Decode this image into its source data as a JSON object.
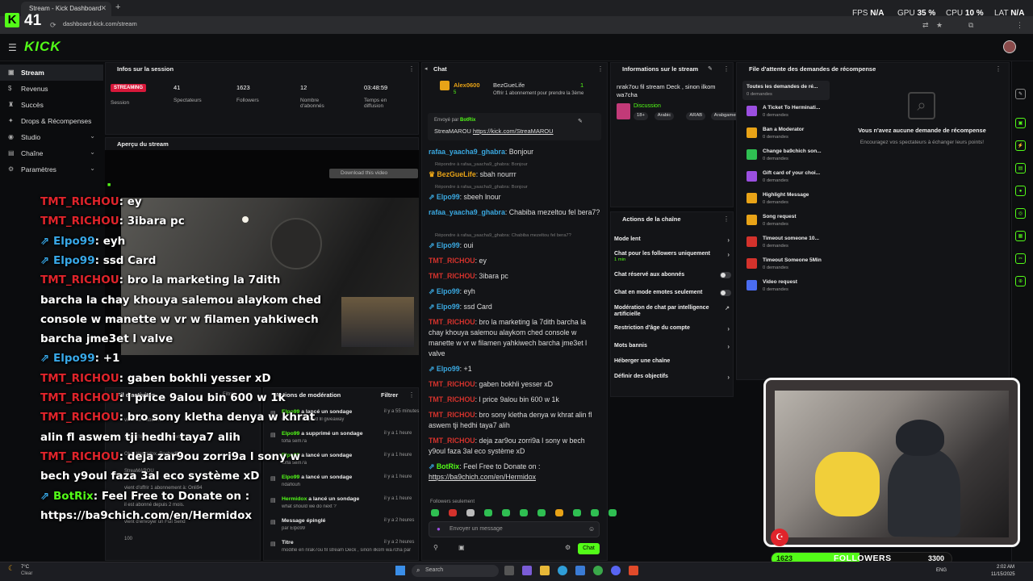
{
  "browser": {
    "tab_title": "Stream - Kick Dashboard",
    "url": "dashboard.kick.com/stream"
  },
  "hud": {
    "fps_label": "FPS",
    "fps_val": "N/A",
    "gpu_label": "GPU",
    "gpu_val": "35 %",
    "cpu_label": "CPU",
    "cpu_val": "10 %",
    "lat_label": "LAT",
    "lat_val": "N/A",
    "counter": "41"
  },
  "nav": {
    "logo": "KICK"
  },
  "sidebar": {
    "items": [
      {
        "label": "Stream"
      },
      {
        "label": "Revenus"
      },
      {
        "label": "Succès"
      },
      {
        "label": "Drops & Récompenses"
      },
      {
        "label": "Studio"
      },
      {
        "label": "Chaîne"
      },
      {
        "label": "Paramètres"
      }
    ]
  },
  "session": {
    "title": "Infos sur la session",
    "status": "STREAMING",
    "session_label": "Session",
    "viewers_val": "41",
    "viewers_label": "Spectateurs",
    "followers_val": "1623",
    "followers_label": "Followers",
    "subs_val": "12",
    "subs_label": "Nombre d'abonnés",
    "time_val": "03:48:59",
    "time_label": "Temps en diffusion"
  },
  "preview": {
    "title": "Aperçu du stream",
    "download": "Download this video"
  },
  "overlay": [
    {
      "user": "TMT_RICHOU",
      "msg": ": ey"
    },
    {
      "user": "TMT_RICHOU",
      "msg": ": 3ibara pc"
    },
    {
      "user": "Elpo99",
      "msg": ": eyh"
    },
    {
      "user": "Elpo99",
      "msg": ": ssd Card"
    },
    {
      "user": "TMT_RICHOU",
      "msg": ": bro la marketing la 7dith"
    },
    {
      "msg": "barcha la chay khouya salemou alaykom ched"
    },
    {
      "msg": "console w manette w vr w filamen yahkiwech"
    },
    {
      "msg": "barcha jme3et l valve"
    },
    {
      "user": "Elpo99",
      "msg": ": +1"
    },
    {
      "user": "TMT_RICHOU",
      "msg": ": gaben bokhli yesser xD"
    },
    {
      "user": "TMT_RICHOU",
      "msg": ": l price 9alou bin 600 w 1k"
    },
    {
      "user": "TMT_RICHOU",
      "msg": ": bro sony kletha denya w khrat"
    },
    {
      "msg": "alin fl aswem tji hedhi taya7 alih"
    },
    {
      "user": "TMT_RICHOU",
      "msg": ": deja zar9ou zorri9a l sony w"
    },
    {
      "msg": "bech y9oul faza 3al eco système xD"
    },
    {
      "user": "BotRix",
      "msg": ": Feel Free to Donate on :"
    },
    {
      "msg": "https://ba9chich.com/en/Hermidox"
    }
  ],
  "activity": {
    "title": "Fil d'activités",
    "filter": "Filtrer",
    "items": [
      {
        "t": "vient de s'abonner"
      },
      {
        "t": "vient d'offrir 5 abonnements à"
      },
      {
        "t": "Oka_Hermidox, Rached95,"
      },
      {
        "t": "StreaMAROU"
      },
      {
        "t": "vient d'offrir 1 abonnement à: Onli94"
      },
      {
        "t": "il est abonné depuis 2 mois."
      },
      {
        "t": "vient d'envoyer un Full Send"
      },
      {
        "t": "100"
      }
    ]
  },
  "moderation": {
    "title": "Actions de modération",
    "filter": "Filtrer",
    "items": [
      {
        "user": "Elpo99",
        "action": "a lancé un sondage",
        "time": "il y a 55 minutes",
        "sub": "chkoun mawjoud lil giveaway"
      },
      {
        "user": "Elpo99",
        "action": "a supprimé un sondage",
        "time": "il y a 1 heure",
        "sub": "tofla sem7a"
      },
      {
        "user": "Elpo99",
        "action": "a lancé un sondage",
        "time": "il y a 1 heure",
        "sub": "tofla sem7a"
      },
      {
        "user": "Elpo99",
        "action": "a lancé un sondage",
        "time": "il y a 1 heure",
        "sub": "ndaflouh"
      },
      {
        "user": "Hermidox",
        "action": "a lancé un sondage",
        "time": "il y a 1 heure",
        "sub": "what should we do next ?"
      },
      {
        "user": "",
        "action": "Message épinglé",
        "time": "il y a 2 heures",
        "sub": "par Elpo99"
      },
      {
        "user": "",
        "action": "Titre",
        "time": "il y a 2 heures",
        "sub": "modifié en nrak7ou fil stream Deck , sinon ilkom wa7cha par Elpo99"
      }
    ]
  },
  "chat": {
    "title": "Chat",
    "top_user": "Alex0600",
    "top_user2": "BezGueLife",
    "top_offer": "Offrir 1 abonnement pour prendre la 3ème",
    "top_count": "1",
    "top_sub": "5",
    "pinned_by": "Envoyé par",
    "pinned_bot": "BotRix",
    "pinned_user": "StreaMAROU",
    "pinned_link": "https://kick.com/StreaMAROU",
    "lines": [
      {
        "u": "rafaa_yaacha9_ghabra",
        "c": "b",
        "m": ": Bonjour"
      },
      {
        "reply": "Répondre à rafaa_yaacha9_ghabra: Bonjour"
      },
      {
        "u": "BezGueLife",
        "c": "y",
        "m": ": sbah nourrr"
      },
      {
        "reply": "Répondre à rafaa_yaacha9_ghabra: Bonjour"
      },
      {
        "u": "Elpo99",
        "c": "b",
        "m": ": sbeeh lnour"
      },
      {
        "u": "rafaa_yaacha9_ghabra",
        "c": "b",
        "m": ": Chabiba mezeltou fel bera7?"
      },
      {
        "reply": "Répondre à rafaa_yaacha9_ghabra: Chabiba mezeltou fel bera7?"
      },
      {
        "u": "Elpo99",
        "c": "b",
        "m": ": oui"
      },
      {
        "u": "TMT_RICHOU",
        "c": "r",
        "m": ": ey"
      },
      {
        "u": "TMT_RICHOU",
        "c": "r",
        "m": ": 3ibara pc"
      },
      {
        "u": "Elpo99",
        "c": "b",
        "m": ": eyh"
      },
      {
        "u": "Elpo99",
        "c": "b",
        "m": ": ssd Card"
      },
      {
        "u": "TMT_RICHOU",
        "c": "r",
        "m": ": bro la marketing la 7dith barcha la chay khouya salemou alaykom ched console w manette w vr w filamen yahkiwech barcha jme3et l valve"
      },
      {
        "u": "Elpo99",
        "c": "b",
        "m": ": +1"
      },
      {
        "u": "TMT_RICHOU",
        "c": "r",
        "m": ": gaben bokhli yesser xD"
      },
      {
        "u": "TMT_RICHOU",
        "c": "r",
        "m": ": l price 9alou bin 600 w 1k"
      },
      {
        "u": "TMT_RICHOU",
        "c": "r",
        "m": ": bro sony kletha denya w khrat alin fl aswem tji hedhi taya7 alih"
      },
      {
        "u": "TMT_RICHOU",
        "c": "r",
        "m": ": deja zar9ou zorri9a l sony w bech y9oul faza 3al eco système xD"
      },
      {
        "u": "BotRix",
        "c": "g",
        "m": ": Feel Free to Donate on :",
        "link": "https://ba9chich.com/en/Hermidox"
      }
    ],
    "followers_only": "Followers seulement",
    "placeholder": "Envoyer un message",
    "send": "Chat"
  },
  "streaminfo": {
    "title": "Informations sur le stream",
    "stream_title": "nrak7ou fil stream Deck , sinon ilkom wa7cha",
    "category": "Discussion",
    "tags": [
      "18+",
      "Arabic",
      "ARAB",
      "Arabgamer"
    ]
  },
  "channel_actions": {
    "title": "Actions de la chaîne",
    "items": [
      {
        "label": "Mode lent",
        "type": "chev"
      },
      {
        "label": "Chat pour les followers uniquement",
        "sub": "1 min",
        "type": "chev"
      },
      {
        "label": "Chat réservé aux abonnés",
        "type": "toggle"
      },
      {
        "label": "Chat en mode emotes seulement",
        "type": "toggle"
      },
      {
        "label": "Modération de chat par intelligence artificielle",
        "type": "ext"
      },
      {
        "label": "Restriction d'âge du compte",
        "type": "chev"
      },
      {
        "label": "Mots bannis",
        "type": "chev"
      },
      {
        "label": "Héberger une chaîne",
        "type": "none"
      },
      {
        "label": "Définir des objectifs",
        "type": "chev"
      }
    ]
  },
  "rewards": {
    "title": "File d'attente des demandes de récompense",
    "all": "Toutes les demandes de ré...",
    "all_sub": "0 demandes",
    "empty_title": "Vous n'avez aucune demande de récompense",
    "empty_sub": "Encouragez vos spectateurs à échanger leurs points!",
    "items": [
      {
        "label": "A Ticket To Herminati...",
        "sub": "0 demandes",
        "color": "#9b4fe0"
      },
      {
        "label": "Ban a Moderator",
        "sub": "0 demandes",
        "color": "#e8a317"
      },
      {
        "label": "Change ba9chich son...",
        "sub": "0 demandes",
        "color": "#2fbf52"
      },
      {
        "label": "Gift card of your choi...",
        "sub": "0 demandes",
        "color": "#9b4fe0"
      },
      {
        "label": "Highlight Message",
        "sub": "0 demandes",
        "color": "#e8a317"
      },
      {
        "label": "Song request",
        "sub": "0 demandes",
        "color": "#e8a317"
      },
      {
        "label": "Timeout someone 10...",
        "sub": "0 demandes",
        "color": "#d4322c"
      },
      {
        "label": "Timeout Someone 5Min",
        "sub": "0 demandes",
        "color": "#d4322c"
      },
      {
        "label": "Video request",
        "sub": "0 demandes",
        "color": "#4a6cf0"
      }
    ]
  },
  "followers_bar": {
    "current": "1623",
    "label": "FOLLOWERS",
    "goal": "3300",
    "fraction": 0.49
  },
  "taskbar": {
    "weather_temp": "7°C",
    "weather": "Clear",
    "search": "Search",
    "lang": "ENG",
    "time": "2:02 AM",
    "date": "11/15/2025"
  }
}
